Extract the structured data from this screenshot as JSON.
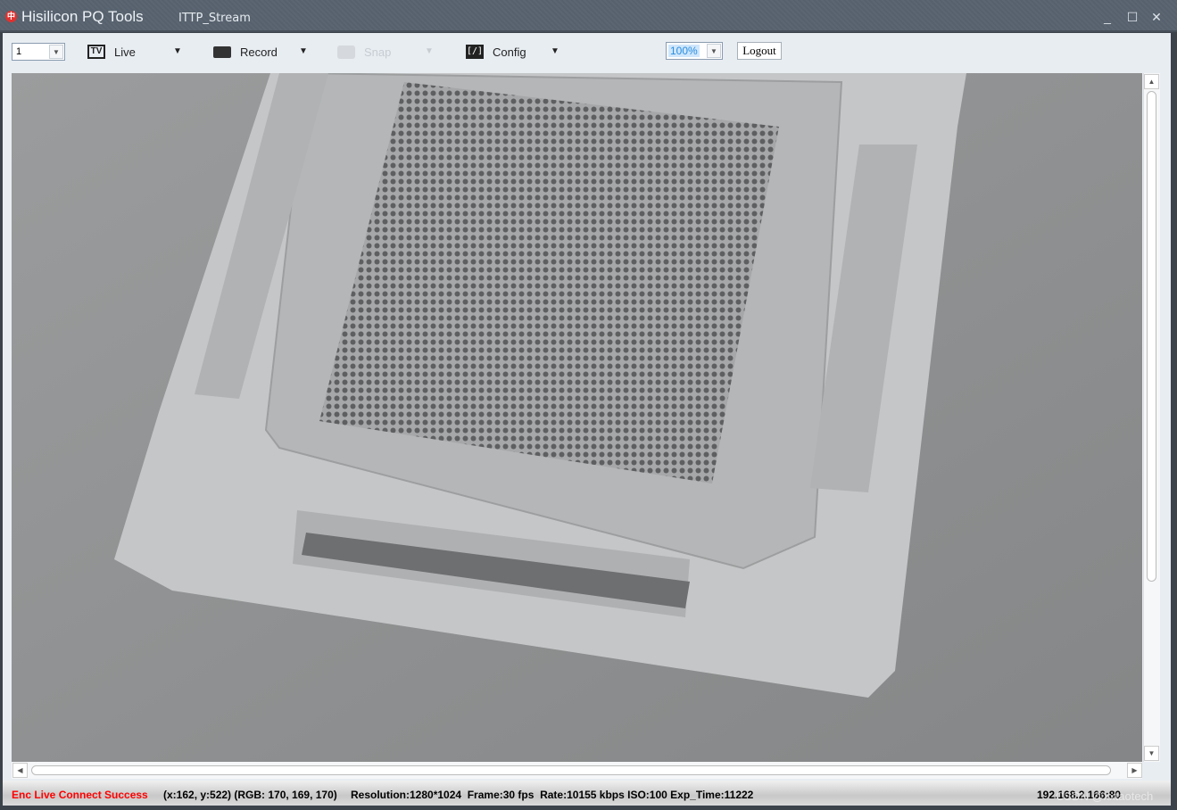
{
  "window": {
    "app_title": "Hisilicon PQ Tools",
    "stream_title": "ITTP_Stream",
    "minimize_icon": "minimize-icon",
    "maximize_icon": "maximize-icon",
    "close_icon": "close-icon"
  },
  "toolbar": {
    "channel_value": "1",
    "live_label": "Live",
    "record_label": "Record",
    "snap_label": "Snap",
    "config_label": "Config",
    "zoom_value": "100%",
    "logout_label": "Logout"
  },
  "status": {
    "connection": "Enc Live Connect Success",
    "connection_color": "#ff0000",
    "pixel_info": "(x:162, y:522) (RGB: 170, 169, 170)",
    "stream_info": "Resolution:1280*1024  Frame:30 fps  Rate:10155 kbps ISO:100 Exp_Time:11222",
    "address": "192.168.2.166:80"
  },
  "watermark": "CSDN @xxtaotech"
}
